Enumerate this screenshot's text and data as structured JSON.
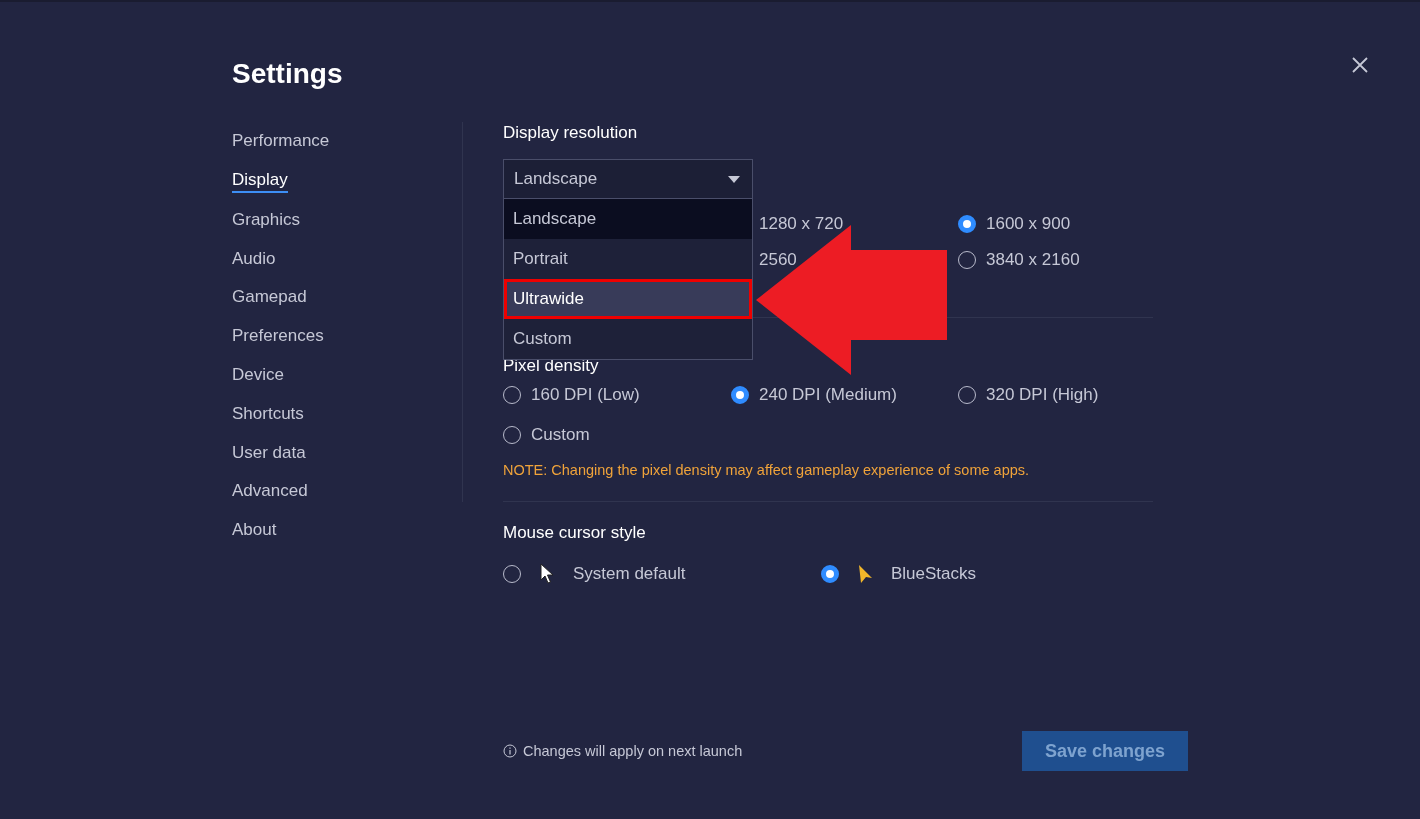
{
  "title": "Settings",
  "nav": [
    {
      "label": "Performance",
      "selected": false
    },
    {
      "label": "Display",
      "selected": true
    },
    {
      "label": "Graphics",
      "selected": false
    },
    {
      "label": "Audio",
      "selected": false
    },
    {
      "label": "Gamepad",
      "selected": false
    },
    {
      "label": "Preferences",
      "selected": false
    },
    {
      "label": "Device",
      "selected": false
    },
    {
      "label": "Shortcuts",
      "selected": false
    },
    {
      "label": "User data",
      "selected": false
    },
    {
      "label": "Advanced",
      "selected": false
    },
    {
      "label": "About",
      "selected": false
    }
  ],
  "display_resolution": {
    "label": "Display resolution",
    "value": "Landscape",
    "menu": [
      {
        "label": "Landscape",
        "selected": true,
        "hovered": false,
        "annotated": false
      },
      {
        "label": "Portrait",
        "selected": false,
        "hovered": false,
        "annotated": false
      },
      {
        "label": "Ultrawide",
        "selected": false,
        "hovered": true,
        "annotated": true
      },
      {
        "label": "Custom",
        "selected": false,
        "hovered": false,
        "annotated": false
      }
    ],
    "options": [
      {
        "label": "1280 x 720"
      },
      {
        "label": "1600 x 900",
        "selected": true
      },
      {
        "label": "2560"
      },
      {
        "label": "3840 x 2160",
        "selected": false
      }
    ]
  },
  "pixel_density": {
    "label": "Pixel density",
    "options": [
      {
        "label": "160 DPI (Low)",
        "selected": false
      },
      {
        "label": "240 DPI (Medium)",
        "selected": true
      },
      {
        "label": "320 DPI (High)",
        "selected": false
      },
      {
        "label": "Custom",
        "selected": false
      }
    ],
    "note": "NOTE: Changing the pixel density may affect gameplay experience of some apps."
  },
  "mouse_cursor": {
    "label": "Mouse cursor style",
    "options": [
      {
        "label": "System default",
        "selected": false,
        "kind": "system"
      },
      {
        "label": "BlueStacks",
        "selected": true,
        "kind": "bluestacks"
      }
    ]
  },
  "footer": {
    "info": "Changes will apply on next launch",
    "save": "Save changes"
  }
}
